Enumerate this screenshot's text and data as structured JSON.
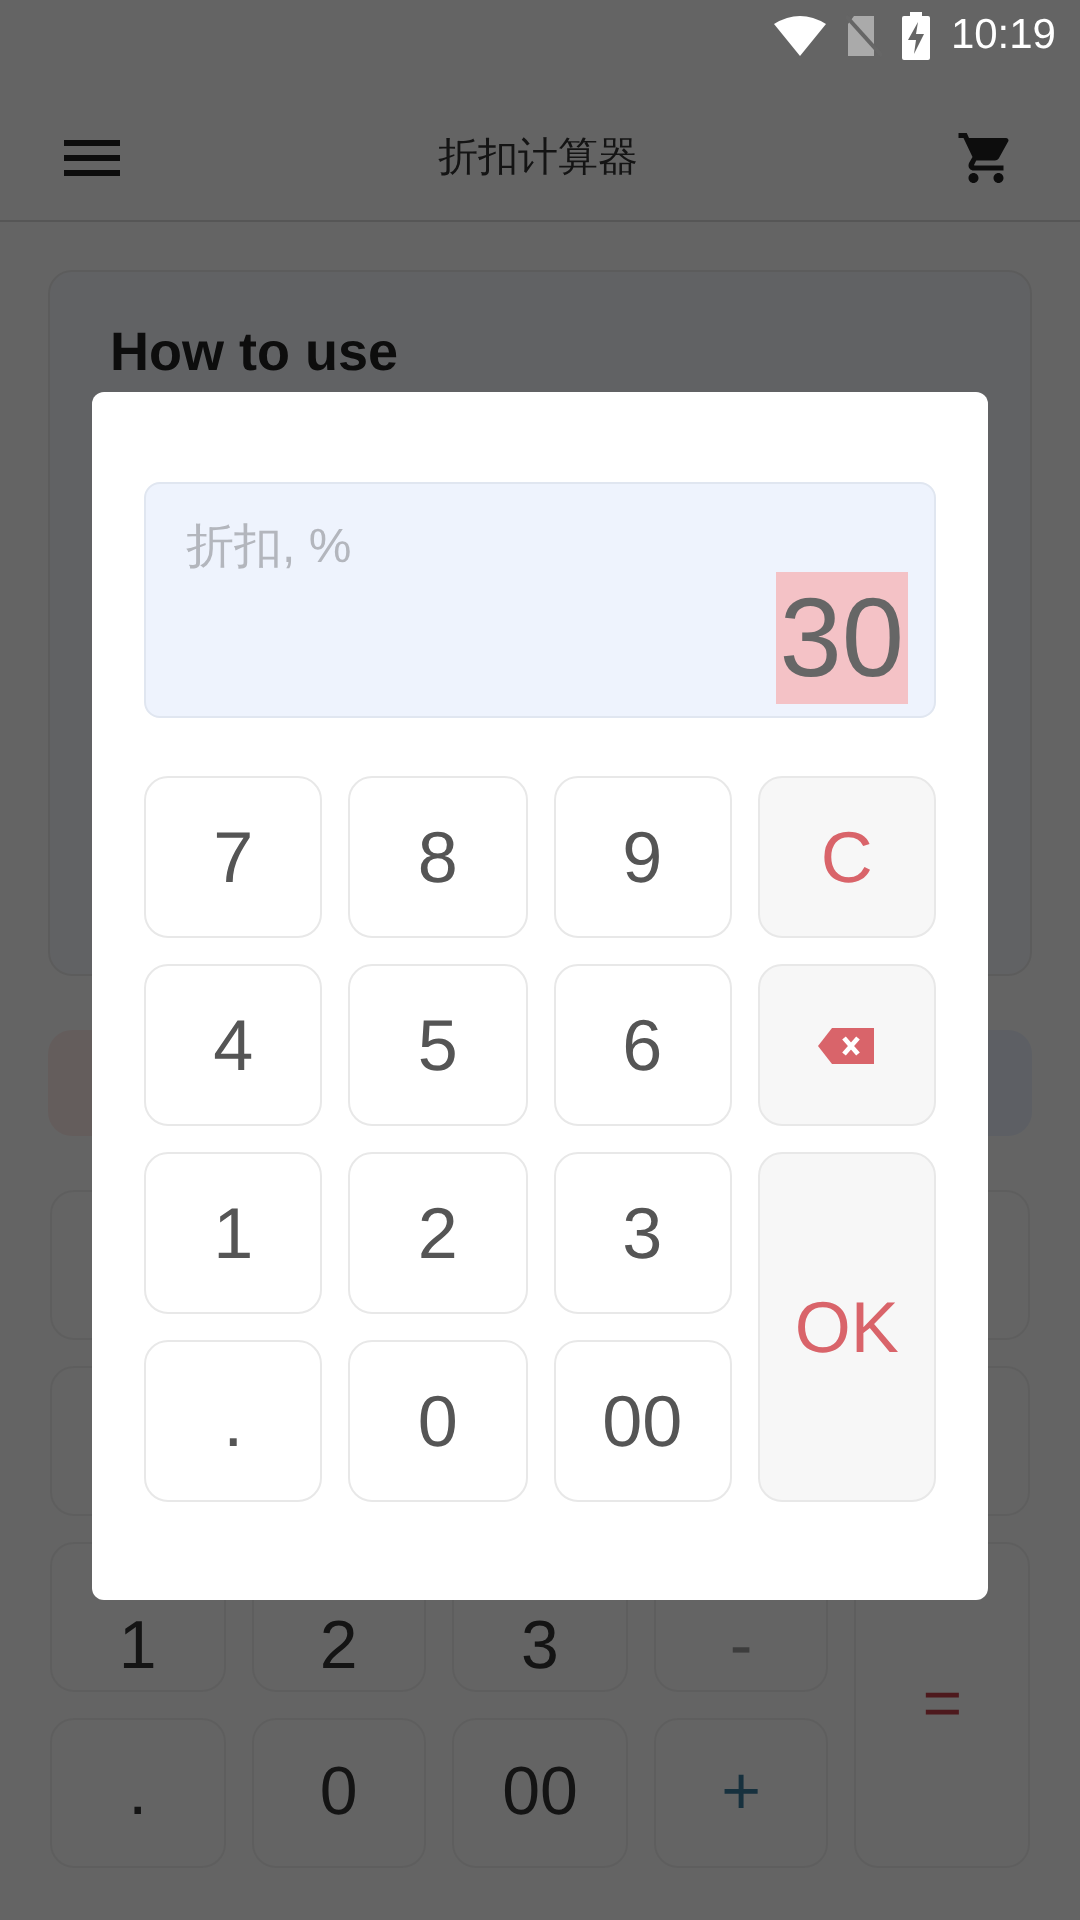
{
  "status_bar": {
    "time": "10:19"
  },
  "app_bar": {
    "title": "折扣计算器"
  },
  "help_card": {
    "title": "How to use"
  },
  "keypad": [
    {
      "label": "1",
      "kind": "digit"
    },
    {
      "label": "2",
      "kind": "digit"
    },
    {
      "label": "3",
      "kind": "digit"
    },
    {
      "label": "-",
      "kind": "minus"
    },
    {
      "label": "=",
      "kind": "equals"
    },
    {
      "label": ".",
      "kind": "digit"
    },
    {
      "label": "0",
      "kind": "digit"
    },
    {
      "label": "00",
      "kind": "digit"
    },
    {
      "label": "+",
      "kind": "plus"
    }
  ],
  "dialog": {
    "field_label": "折扣, %",
    "value": "30",
    "value_selected": true,
    "keys": [
      {
        "label": "7",
        "kind": "digit"
      },
      {
        "label": "8",
        "kind": "digit"
      },
      {
        "label": "9",
        "kind": "digit"
      },
      {
        "label": "C",
        "kind": "clear"
      },
      {
        "label": "4",
        "kind": "digit"
      },
      {
        "label": "5",
        "kind": "digit"
      },
      {
        "label": "6",
        "kind": "digit"
      },
      {
        "kind": "backspace"
      },
      {
        "label": "1",
        "kind": "digit"
      },
      {
        "label": "2",
        "kind": "digit"
      },
      {
        "label": "3",
        "kind": "digit"
      },
      {
        "label": "OK",
        "kind": "ok"
      },
      {
        "label": ".",
        "kind": "digit"
      },
      {
        "label": "0",
        "kind": "digit"
      },
      {
        "label": "00",
        "kind": "digit"
      }
    ]
  }
}
